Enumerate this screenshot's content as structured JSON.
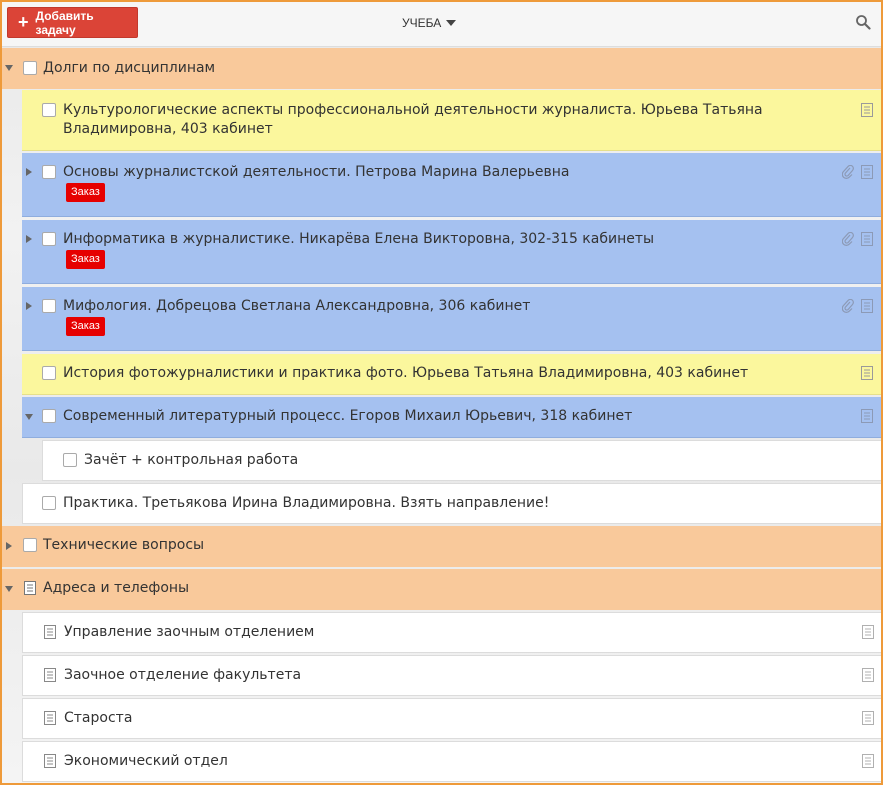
{
  "toolbar": {
    "add_task_label": "Добавить задачу",
    "project_name": "УЧЕБА"
  },
  "groups": [
    {
      "label": "Долги по дисциплинам",
      "color": "#f9c99b",
      "items": [
        {
          "label": "Культурологические аспекты профессиональной деятельности журналиста. Юрьева Татьяна Владимировна, 403 кабинет",
          "color": "#fbf79d"
        },
        {
          "label": "Основы журналистской деятельности. Петрова Марина Валерьевна",
          "badge": "Заказ",
          "color": "#a5c1f0"
        },
        {
          "label": "Информатика в журналистике. Никарёва Елена Викторовна, 302-315 кабинеты",
          "badge": "Заказ",
          "color": "#a5c1f0"
        },
        {
          "label": "Мифология. Добрецова Светлана Александровна, 306 кабинет",
          "badge": "Заказ",
          "color": "#a5c1f0"
        },
        {
          "label": "История фотожурналистики и практика фото. Юрьева Татьяна Владимировна, 403 кабинет",
          "color": "#fbf79d"
        },
        {
          "label": "Современный литературный процесс. Егоров Михаил Юрьевич, 318 кабинет",
          "color": "#a5c1f0",
          "subitems": [
            {
              "label": "Зачёт + контрольная работа"
            }
          ]
        },
        {
          "label": "Практика. Третьякова Ирина Владимировна. Взять направление!",
          "color": "#ffffff"
        }
      ]
    },
    {
      "label": "Технические вопросы",
      "color": "#f9c99b"
    },
    {
      "label": "Адреса и телефоны",
      "color": "#f9c99b",
      "items": [
        {
          "label": "Управление заочным отделением"
        },
        {
          "label": "Заочное отделение факультета"
        },
        {
          "label": "Староста"
        },
        {
          "label": "Экономический отдел"
        }
      ]
    }
  ]
}
